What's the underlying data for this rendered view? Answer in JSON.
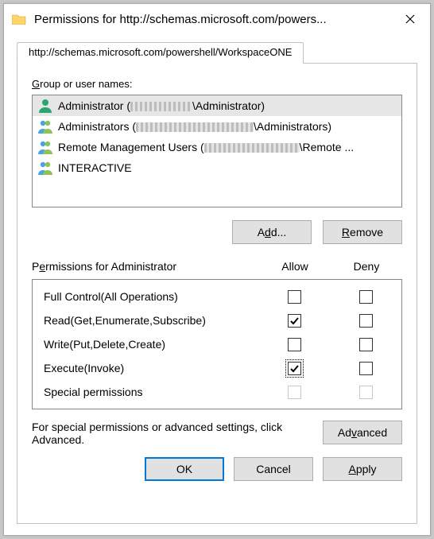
{
  "window": {
    "title": "Permissions for http://schemas.microsoft.com/powers..."
  },
  "tab": {
    "label": "http://schemas.microsoft.com/powershell/WorkspaceONE"
  },
  "groups": {
    "label_pre": "G",
    "label_post": "roup or user names:",
    "items": [
      {
        "prefix": "Administrator (",
        "masked_w": 78,
        "suffix": "\\Administrator)",
        "type": "user",
        "selected": true
      },
      {
        "prefix": "Administrators (",
        "masked_w": 148,
        "suffix": "\\Administrators)",
        "type": "group",
        "selected": false
      },
      {
        "prefix": "Remote Management Users (",
        "masked_w": 120,
        "suffix": "\\Remote ...",
        "type": "group",
        "selected": false
      },
      {
        "prefix": "INTERACTIVE",
        "masked_w": 0,
        "suffix": "",
        "type": "group",
        "selected": false
      }
    ]
  },
  "btn_add_pre": "A",
  "btn_add_u": "d",
  "btn_add_post": "d...",
  "btn_remove_u": "R",
  "btn_remove_post": "emove",
  "perm_header_pre": "P",
  "perm_header_u": "e",
  "perm_header_post": "rmissions for Administrator",
  "col_allow": "Allow",
  "col_deny": "Deny",
  "perms": [
    {
      "name": "Full Control(All Operations)",
      "allow": false,
      "deny": false,
      "focus": false,
      "disabled": false
    },
    {
      "name": "Read(Get,Enumerate,Subscribe)",
      "allow": true,
      "deny": false,
      "focus": false,
      "disabled": false
    },
    {
      "name": "Write(Put,Delete,Create)",
      "allow": false,
      "deny": false,
      "focus": false,
      "disabled": false
    },
    {
      "name": "Execute(Invoke)",
      "allow": true,
      "deny": false,
      "focus": true,
      "disabled": false
    },
    {
      "name": "Special permissions",
      "allow": false,
      "deny": false,
      "focus": false,
      "disabled": true
    }
  ],
  "adv_text": "For special permissions or advanced settings, click Advanced.",
  "btn_adv_pre": "Ad",
  "btn_adv_u": "v",
  "btn_adv_post": "anced",
  "btn_ok": "OK",
  "btn_cancel": "Cancel",
  "btn_apply_pre": "",
  "btn_apply_u": "A",
  "btn_apply_post": "pply"
}
